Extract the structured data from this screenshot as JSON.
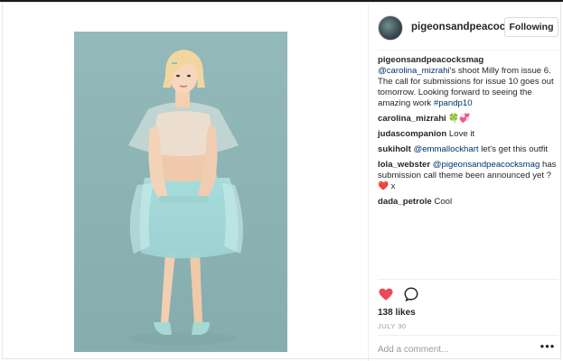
{
  "post": {
    "username": "pigeonsandpeacoc",
    "follow_label": "Following",
    "caption": {
      "username": "pigeonsandpeacocksmag",
      "mention": "@carolina_mizrahi",
      "text": "'s shoot Milly from issue 6. The call for submissions for issue 10 goes out tomorrow. Looking forward to seeing the amazing work",
      "hashtag": "#pandp10"
    },
    "comments": [
      {
        "username": "carolina_mizrahi",
        "text": "",
        "emojis": [
          "🍀",
          "💞"
        ]
      },
      {
        "username": "judascompanion",
        "text": "Love it"
      },
      {
        "username": "sukiholt",
        "mention": "@emmallockhart",
        "text": "let's get this outfit"
      },
      {
        "username": "lola_webster",
        "mention": "@pigeonsandpeacocksmag",
        "text": "has submission call theme been announced yet ?",
        "emoji": "❤️",
        "tail": "x"
      },
      {
        "username": "dada_petrole",
        "text": "Cool"
      }
    ],
    "likes": "138 likes",
    "date": "JULY 30",
    "add_comment_placeholder": "Add a comment...",
    "more_label": "•••"
  },
  "colors": {
    "background": "#8fb5b6",
    "like_red": "#ed4956",
    "link": "#003569"
  },
  "icons": [
    "heart-icon",
    "comment-icon",
    "more-icon"
  ]
}
